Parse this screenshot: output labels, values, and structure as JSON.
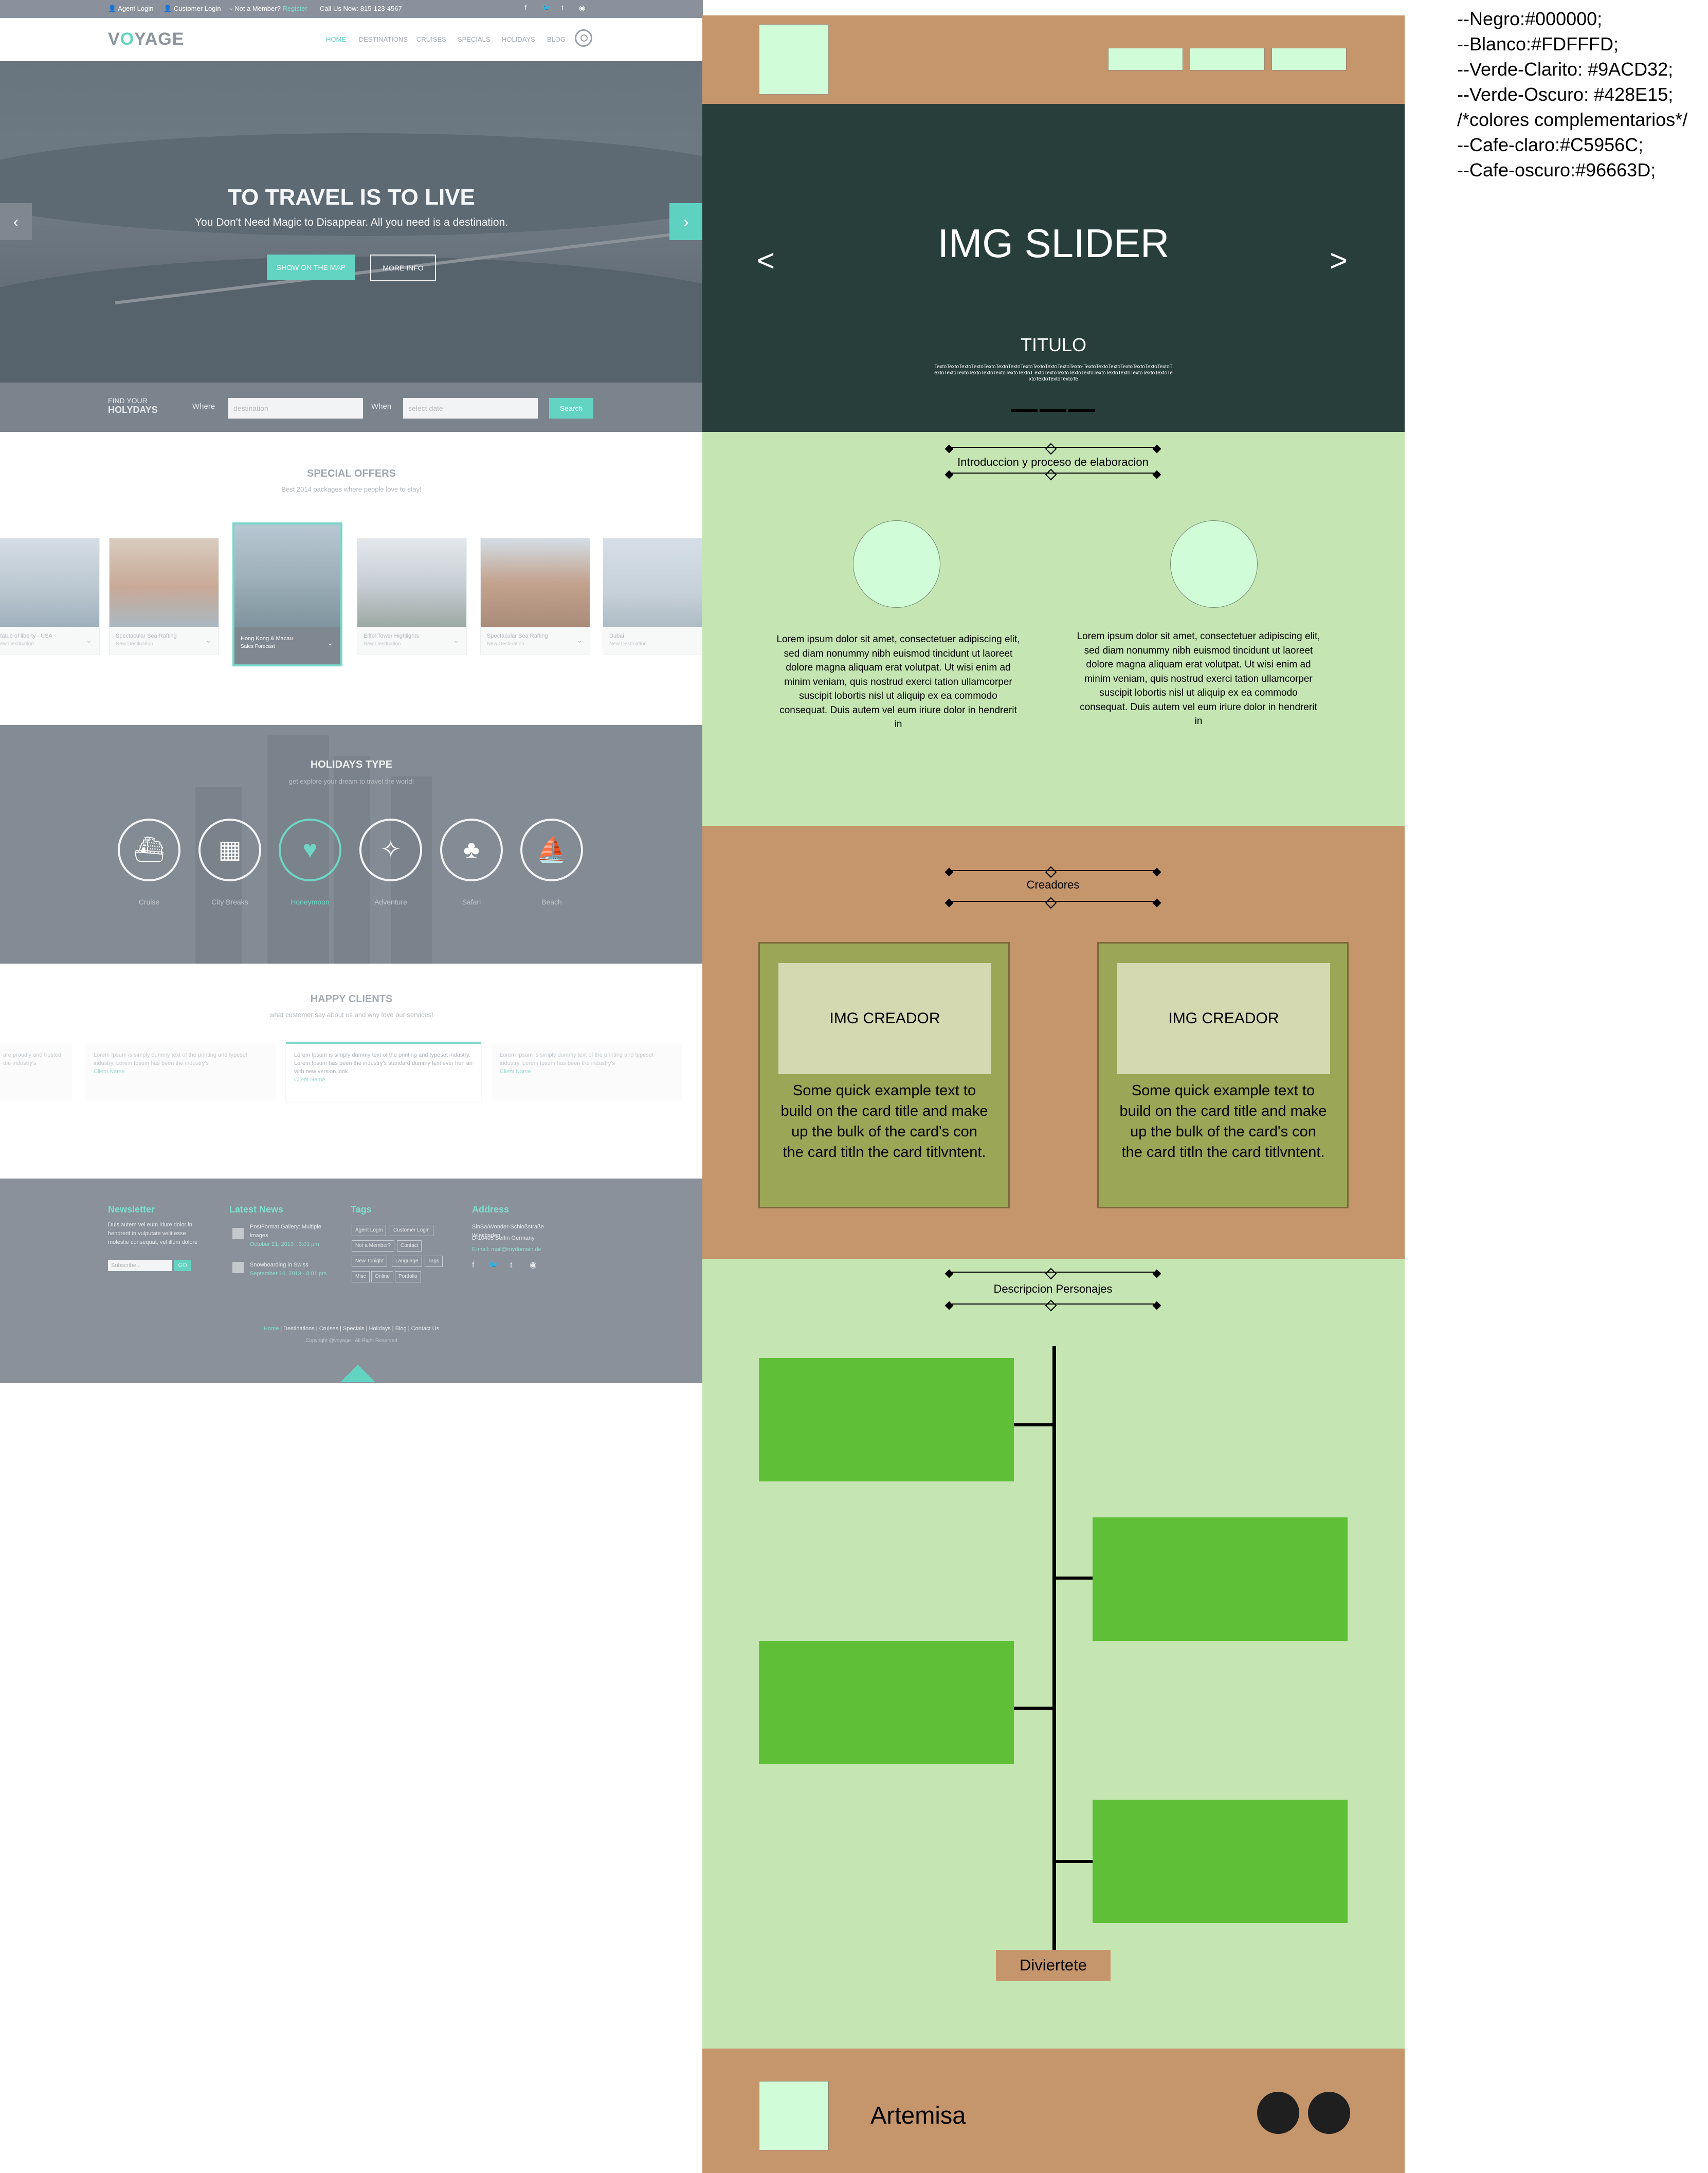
{
  "reference_site": {
    "topbar": {
      "agent_login": "Agent Login",
      "customer_login": "Customer Login",
      "not_member": "Not a Member?",
      "register": "Register",
      "call": "Call Us Now: 815-123-4567",
      "social_icons": [
        "facebook-icon",
        "twitter-icon",
        "tumblr-icon",
        "dribbble-icon"
      ]
    },
    "brand": {
      "logo_left": "V",
      "logo_o": "O",
      "logo_right": "YAGE"
    },
    "nav": [
      "HOME",
      "DESTINATIONS",
      "CRUISES",
      "SPECIALS",
      "HOLIDAYS",
      "BLOG"
    ],
    "hero": {
      "title": "TO TRAVEL IS TO LIVE",
      "subtitle": "You Don't Need Magic to Disappear. All you need is a destination.",
      "btn_map": "SHOW ON THE MAP",
      "btn_more": "MORE INFO",
      "prev": "‹",
      "next": "›"
    },
    "find": {
      "label_top": "FIND YOUR",
      "label_bottom": "HOLYDAYS",
      "where_label": "Where",
      "where_placeholder": "destination",
      "when_label": "When",
      "when_placeholder": "select date",
      "search": "Search"
    },
    "special_offers": {
      "title": "SPECIAL OFFERS",
      "subtitle": "Best 2014 packages where people love to stay!",
      "cards": [
        {
          "title": "Statue of liberty - USA",
          "sub": "New Destination"
        },
        {
          "title": "Spectacular Sea Rafting",
          "sub": "New Destination"
        },
        {
          "title": "Hong Kong & Macau",
          "sub": "Sales Forecast"
        },
        {
          "title": "Eiffel Tower Highlights",
          "sub": "New Destination"
        },
        {
          "title": "Spectacular Sea Rafting",
          "sub": "New Destination"
        },
        {
          "title": "Dubai",
          "sub": "New Destination"
        }
      ]
    },
    "holidays": {
      "title": "HOLIDAYS TYPE",
      "subtitle": "get explore your dream to travel the world!",
      "types": [
        {
          "label": "Cruise",
          "icon": "cruise-icon",
          "glyph": "⛴"
        },
        {
          "label": "City Breaks",
          "icon": "city-icon",
          "glyph": "▦"
        },
        {
          "label": "Honeymoon",
          "icon": "heart-icon",
          "glyph": "♥"
        },
        {
          "label": "Adventure",
          "icon": "compass-icon",
          "glyph": "✧"
        },
        {
          "label": "Safari",
          "icon": "palm-icon",
          "glyph": "♣"
        },
        {
          "label": "Beach",
          "icon": "boat-icon",
          "glyph": "⛵"
        }
      ]
    },
    "happy_clients": {
      "title": "HAPPY CLIENTS",
      "subtitle": "what customer say about us and why love our services!",
      "testimonials": [
        {
          "text": "are proudly and trusted the industry's",
          "who": ""
        },
        {
          "text": "Lorem Ipsum is simply dummy text of the printing and typeset industry. Lorem Ipsum has been the industry's",
          "who": "Client Name"
        },
        {
          "text": "Lorem Ipsum is simply dummy text of the printing and typeset industry. Lorem Ipsum has been the industry's standard dummy text ever hen an with new version look.",
          "who": "Client Name"
        },
        {
          "text": "Lorem Ipsum is simply dummy text of the printing and typeset industry. Lorem Ipsum has been the industry's",
          "who": "Client Name"
        }
      ]
    },
    "footer": {
      "newsletter_title": "Newsletter",
      "newsletter_text": "Duis autem vel eum iriure dolor in hendrerit in vulputate velit esse molestie consequat, vel illum dolore",
      "subscribe_placeholder": "Subscribe...",
      "subscribe_btn": "GO",
      "news_title": "Latest News",
      "news": [
        {
          "title": "PostFormat Gallery: Multiple images",
          "date": "October 21, 2013 · 3:01 pm"
        },
        {
          "title": "Snowboarding in Swiss",
          "date": "September 10, 2013 · 8:01 pm"
        }
      ],
      "tags_title": "Tags",
      "tags": [
        "Agent Login",
        "Customer Login",
        "Not a Member?",
        "Contact",
        "New Tonight",
        "Language",
        "Tags",
        "Misc",
        "Online",
        "Portfolio"
      ],
      "address_title": "Address",
      "address": [
        "SinSa/Wonder-Schloßstraße Wiesbaden",
        "D-10405 Berlin Germany",
        "E-mail: mail@mydomain.de"
      ],
      "links": [
        "Home",
        "Destinations",
        "Cruises",
        "Specials",
        "Holidays",
        "Blog",
        "Contact Us"
      ],
      "copyright": "Copyright @voyage . All Right Reserved"
    }
  },
  "mockup": {
    "slider": {
      "title": "IMG SLIDER",
      "prev": "<",
      "next": ">",
      "subtitle": "TITULO",
      "text": "TextoTextoTextoTextoTextoTextoTextoTextoTextoTextoTextoTexto-TextoTextoTextoTextoTextoTextoTextoTextoTextoTextoTextoTextoTextoTextoTextoT extoTextoTextoTextoTextoTextoTextoTextoTextoTextoTextoTextoTextoTextoTextoTe"
    },
    "intro": {
      "heading": "Introduccion y proceso de elaboracion",
      "paragraph_left": "Lorem ipsum dolor sit amet, consectetuer adipiscing elit, sed diam nonummy nibh euismod tincidunt ut laoreet dolore magna aliquam erat volutpat. Ut wisi enim ad minim veniam, quis nostrud exerci tation ullamcorper suscipit lobortis nisl ut aliquip ex ea commodo consequat. Duis autem vel eum iriure dolor in hendrerit in",
      "paragraph_right": "Lorem ipsum dolor sit amet, consectetuer adipiscing elit, sed diam nonummy nibh euismod tincidunt ut laoreet dolore magna aliquam erat volutpat. Ut wisi enim ad minim veniam, quis nostrud exerci tation ullamcorper suscipit lobortis nisl ut aliquip ex ea commodo consequat. Duis autem vel eum iriure dolor in hendrerit in"
    },
    "creators": {
      "heading": "Creadores",
      "cards": [
        {
          "img": "IMG CREADOR",
          "text": "Some quick example text to build on the card title and make up the bulk of the card's con the card titln the card titlvntent."
        },
        {
          "img": "IMG CREADOR",
          "text": "Some quick example text to build on the card title and make up the bulk of the card's con the card titln the card titlvntent."
        }
      ]
    },
    "characters": {
      "heading": "Descripcion Personajes",
      "button": "Diviertete"
    },
    "footer": {
      "name": "Artemisa"
    }
  },
  "color_notes": [
    "--Negro:#000000;",
    "--Blanco:#FDFFFD;",
    "--Verde-Clarito: #9ACD32;",
    "--Verde-Oscuro: #428E15;",
    "/*colores complementarios*/",
    "--Cafe-claro:#C5956C;",
    "--Cafe-oscuro:#96663D;"
  ],
  "colors": {
    "mock_brown": "#c5956c",
    "mock_dark": "#283e3b",
    "mock_light_green": "#c5e6b2",
    "mock_mint": "#d0fcd8",
    "mock_card": "#9ca657",
    "mock_timeline_box": "#5fbf37",
    "ref_accent": "#63d3c2"
  }
}
